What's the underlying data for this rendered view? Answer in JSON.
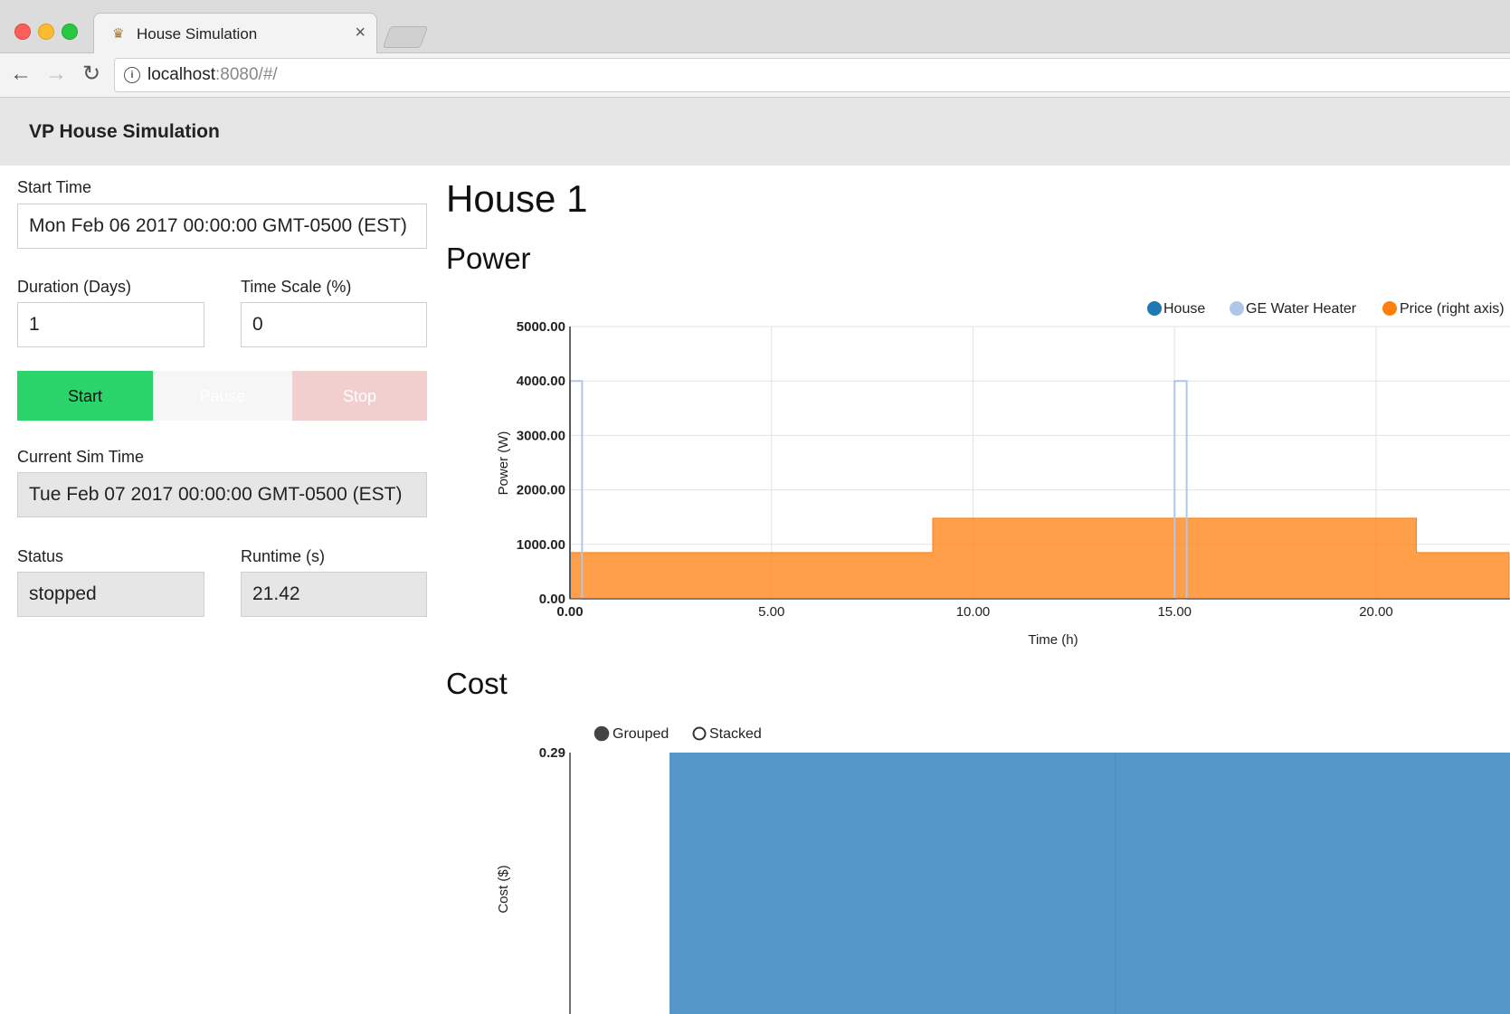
{
  "browser": {
    "tab_title": "House Simulation",
    "url_host": "localhost",
    "url_path": ":8080/#/"
  },
  "app": {
    "title": "VP House Simulation"
  },
  "controls": {
    "start_time_label": "Start Time",
    "start_time_value": "Mon Feb 06 2017 00:00:00 GMT-0500 (EST)",
    "duration_label": "Duration (Days)",
    "duration_value": "1",
    "timescale_label": "Time Scale (%)",
    "timescale_value": "0",
    "start_button": "Start",
    "pause_button": "Pause",
    "stop_button": "Stop",
    "current_sim_time_label": "Current Sim Time",
    "current_sim_time_value": "Tue Feb 07 2017 00:00:00 GMT-0500 (EST)",
    "status_label": "Status",
    "status_value": "stopped",
    "runtime_label": "Runtime (s)",
    "runtime_value": "21.42"
  },
  "main": {
    "house_title": "House 1",
    "power_title": "Power",
    "cost_title": "Cost"
  },
  "colors": {
    "house": "#1f77b4",
    "water_heater": "#aec7e8",
    "price": "#ff7f0e",
    "cost_bar": "#5497c8",
    "start_btn": "#2bd46a"
  },
  "chart_data": [
    {
      "type": "line",
      "title": "Power",
      "xlabel": "Time (h)",
      "ylabel": "Power (W)",
      "xlim": [
        0,
        23.3
      ],
      "ylim": [
        0,
        5000
      ],
      "x_ticks": [
        "0.00",
        "5.00",
        "10.00",
        "15.00",
        "20.00"
      ],
      "y_ticks": [
        "0.00",
        "1000.00",
        "2000.00",
        "3000.00",
        "4000.00",
        "5000.00"
      ],
      "grid": true,
      "legend_position": "top-right",
      "series": [
        {
          "name": "House",
          "points": []
        },
        {
          "name": "GE Water Heater",
          "points": [
            [
              0,
              0
            ],
            [
              0,
              4000
            ],
            [
              0.3,
              4000
            ],
            [
              0.3,
              0
            ],
            [
              15.0,
              0
            ],
            [
              15.0,
              4000
            ],
            [
              15.3,
              4000
            ],
            [
              15.3,
              0
            ],
            [
              23.3,
              0
            ]
          ]
        },
        {
          "name": "Price (right axis)",
          "area": true,
          "points": [
            [
              0,
              850
            ],
            [
              9.0,
              850
            ],
            [
              9.0,
              1480
            ],
            [
              21.0,
              1480
            ],
            [
              21.0,
              850
            ],
            [
              23.3,
              850
            ]
          ]
        }
      ]
    },
    {
      "type": "bar",
      "title": "Cost",
      "ylabel": "Cost ($)",
      "y_ticks": [
        "0.29"
      ],
      "legend": [
        {
          "label": "Grouped",
          "selected": true
        },
        {
          "label": "Stacked",
          "selected": false
        }
      ],
      "series": [
        {
          "values": [
            0.29,
            0.29
          ]
        }
      ]
    }
  ]
}
